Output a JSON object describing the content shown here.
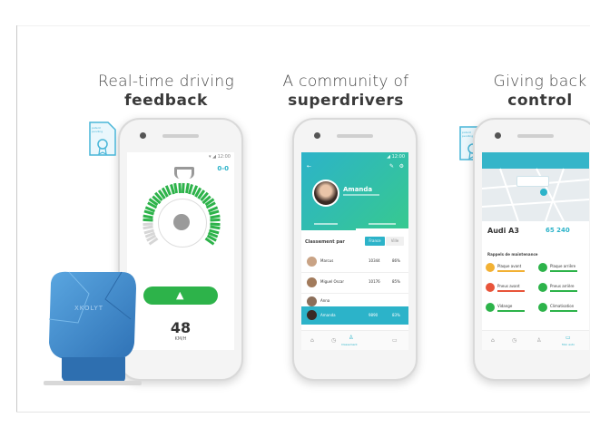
{
  "panels": [
    {
      "line1": "Real-time driving",
      "line2": "feedback"
    },
    {
      "line1": "A community of",
      "line2": "superdrivers"
    },
    {
      "line1": "Giving back",
      "line2": "control"
    }
  ],
  "phone1": {
    "speed_value": "48",
    "speed_unit": "KM/H",
    "top_right": "0-0"
  },
  "phone2": {
    "profile_name": "Amanda",
    "classement_label": "Classement par",
    "filter_active": "France",
    "filter_other": "Ville",
    "rows": [
      {
        "name": "Marcus",
        "score": "10344",
        "pct": "86%"
      },
      {
        "name": "Miguel Oscar",
        "score": "10176",
        "pct": "85%"
      },
      {
        "name": "Anna",
        "score": "10099",
        "pct": "84%"
      },
      {
        "name": "Amanda",
        "score": "9890",
        "pct": "83%"
      }
    ],
    "tab_active": "Classement"
  },
  "phone3": {
    "car_model": "Audi A3",
    "car_km": "65 240",
    "section_label": "Rappels de maintenance",
    "items": [
      {
        "label": "Plaque avant",
        "color": "#f2b134"
      },
      {
        "label": "Plaque arrière",
        "color": "#2db34a"
      },
      {
        "label": "Pneus avant",
        "color": "#e8543a"
      },
      {
        "label": "Pneus arrière",
        "color": "#2db34a"
      },
      {
        "label": "Vidange",
        "color": "#2db34a"
      },
      {
        "label": "Climatisation",
        "color": "#2db34a"
      }
    ],
    "tab_active": "Mon auto"
  },
  "device": {
    "brand": "XKOLYT"
  },
  "badges": [
    {
      "text": "patent pending"
    },
    {
      "text": "patent pending"
    }
  ],
  "colors": {
    "green": "#2db34a",
    "teal": "#2cb3c9",
    "blue_device": "#3c89cc"
  }
}
